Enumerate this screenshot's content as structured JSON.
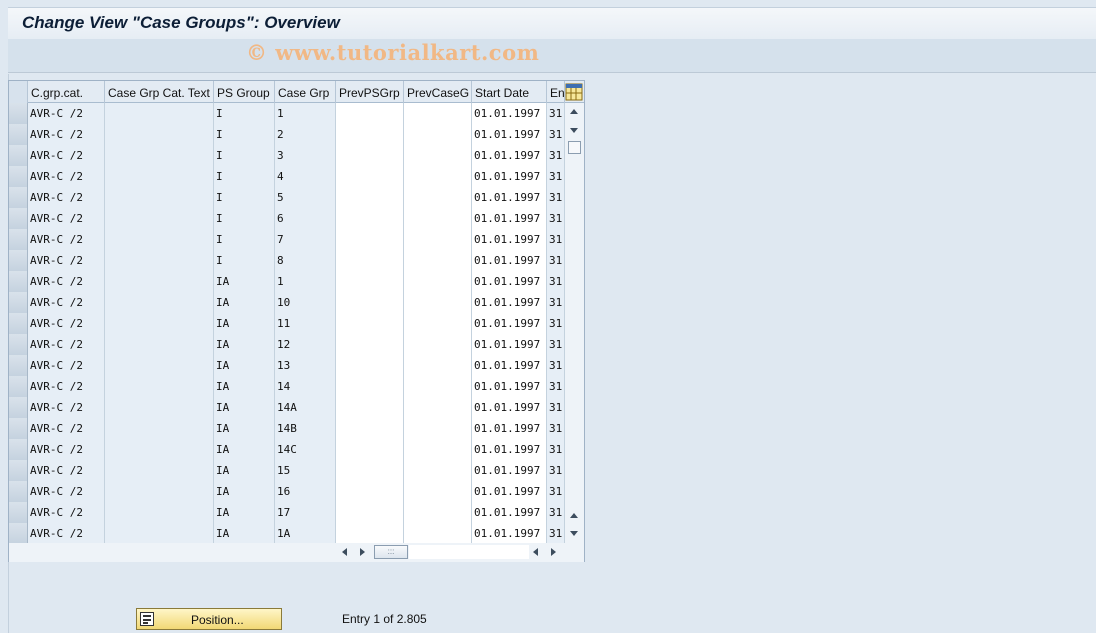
{
  "title": "Change View \"Case Groups\": Overview",
  "watermark": "© www.tutorialkart.com",
  "table": {
    "columns": [
      "C.grp.cat.",
      "Case Grp Cat. Text",
      "PS Group",
      "Case Grp",
      "PrevPSGrp",
      "PrevCaseG",
      "Start Date",
      "En"
    ],
    "rows": [
      [
        "AVR-C /2",
        "",
        "I",
        "1",
        "",
        "",
        "01.01.1997",
        "31"
      ],
      [
        "AVR-C /2",
        "",
        "I",
        "2",
        "",
        "",
        "01.01.1997",
        "31"
      ],
      [
        "AVR-C /2",
        "",
        "I",
        "3",
        "",
        "",
        "01.01.1997",
        "31"
      ],
      [
        "AVR-C /2",
        "",
        "I",
        "4",
        "",
        "",
        "01.01.1997",
        "31"
      ],
      [
        "AVR-C /2",
        "",
        "I",
        "5",
        "",
        "",
        "01.01.1997",
        "31"
      ],
      [
        "AVR-C /2",
        "",
        "I",
        "6",
        "",
        "",
        "01.01.1997",
        "31"
      ],
      [
        "AVR-C /2",
        "",
        "I",
        "7",
        "",
        "",
        "01.01.1997",
        "31"
      ],
      [
        "AVR-C /2",
        "",
        "I",
        "8",
        "",
        "",
        "01.01.1997",
        "31"
      ],
      [
        "AVR-C /2",
        "",
        "IA",
        "1",
        "",
        "",
        "01.01.1997",
        "31"
      ],
      [
        "AVR-C /2",
        "",
        "IA",
        "10",
        "",
        "",
        "01.01.1997",
        "31"
      ],
      [
        "AVR-C /2",
        "",
        "IA",
        "11",
        "",
        "",
        "01.01.1997",
        "31"
      ],
      [
        "AVR-C /2",
        "",
        "IA",
        "12",
        "",
        "",
        "01.01.1997",
        "31"
      ],
      [
        "AVR-C /2",
        "",
        "IA",
        "13",
        "",
        "",
        "01.01.1997",
        "31"
      ],
      [
        "AVR-C /2",
        "",
        "IA",
        "14",
        "",
        "",
        "01.01.1997",
        "31"
      ],
      [
        "AVR-C /2",
        "",
        "IA",
        "14A",
        "",
        "",
        "01.01.1997",
        "31"
      ],
      [
        "AVR-C /2",
        "",
        "IA",
        "14B",
        "",
        "",
        "01.01.1997",
        "31"
      ],
      [
        "AVR-C /2",
        "",
        "IA",
        "14C",
        "",
        "",
        "01.01.1997",
        "31"
      ],
      [
        "AVR-C /2",
        "",
        "IA",
        "15",
        "",
        "",
        "01.01.1997",
        "31"
      ],
      [
        "AVR-C /2",
        "",
        "IA",
        "16",
        "",
        "",
        "01.01.1997",
        "31"
      ],
      [
        "AVR-C /2",
        "",
        "IA",
        "17",
        "",
        "",
        "01.01.1997",
        "31"
      ],
      [
        "AVR-C /2",
        "",
        "IA",
        "1A",
        "",
        "",
        "01.01.1997",
        "31"
      ]
    ]
  },
  "position_button": "Position...",
  "entry_text": "Entry 1 of 2.805",
  "icons": {
    "settings": "table-settings-icon",
    "position": "position-icon"
  }
}
